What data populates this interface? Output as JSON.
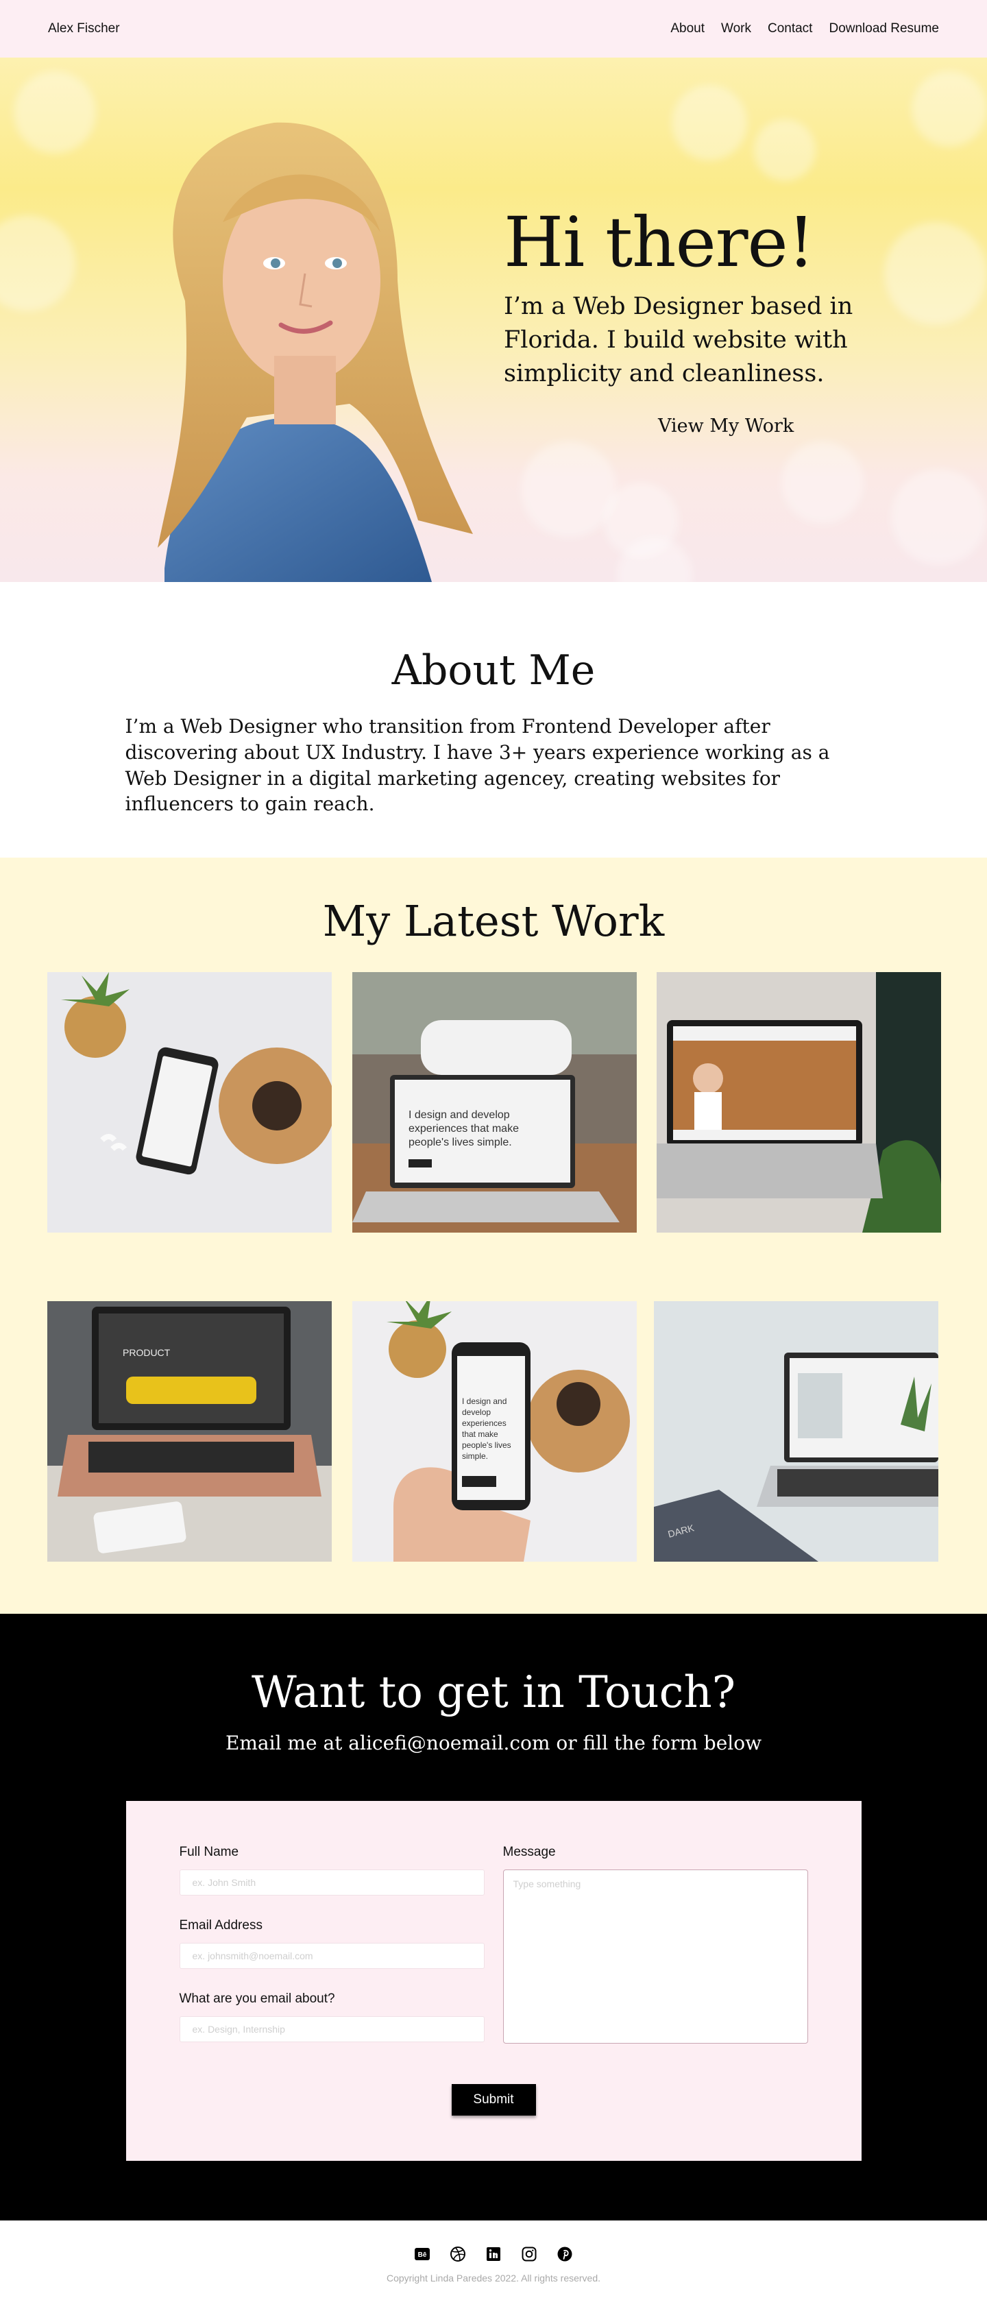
{
  "nav": {
    "brand": "Alex Fischer",
    "links": [
      "About",
      "Work",
      "Contact",
      "Download Resume"
    ]
  },
  "hero": {
    "title": "Hi there!",
    "subtitle": "I’m a Web Designer based in Florida. I build website with simplicity and cleanliness.",
    "cta": "View My Work"
  },
  "about": {
    "title": "About Me",
    "body": "I’m a Web Designer who transition from Frontend Developer after discovering about UX Industry. I have 3+ years experience working as a Web Designer in a digital marketing agencey, creating websites for influencers to gain reach."
  },
  "work": {
    "title": "My Latest Work",
    "thumbs": {
      "t2_text": "I design and develop experiences that make people's lives simple.",
      "t4_text": "PRODUCT",
      "t5_text": "I design and develop experiences that make people's lives simple.",
      "t6_text": "DARK"
    }
  },
  "contact": {
    "title": "Want to get in Touch?",
    "subtitle": "Email me at alicefi@noemail.com or fill the form below",
    "form": {
      "full_name_label": "Full Name",
      "full_name_placeholder": "ex. John Smith",
      "email_label": "Email Address",
      "email_placeholder": "ex. johnsmith@noemail.com",
      "about_label": "What are you email about?",
      "about_placeholder": "ex. Design, Internship",
      "message_label": "Message",
      "message_placeholder": "Type something",
      "submit": "Submit"
    }
  },
  "footer": {
    "icons": [
      "behance-icon",
      "dribbble-icon",
      "linkedin-icon",
      "instagram-icon",
      "pinterest-icon"
    ],
    "copyright": "Copyright Linda Paredes 2022. All rights reserved."
  },
  "colors": {
    "nav_bg": "#fdeef3",
    "work_bg": "#fff8d8",
    "contact_bg": "#000000",
    "form_bg": "#fdeef3"
  }
}
